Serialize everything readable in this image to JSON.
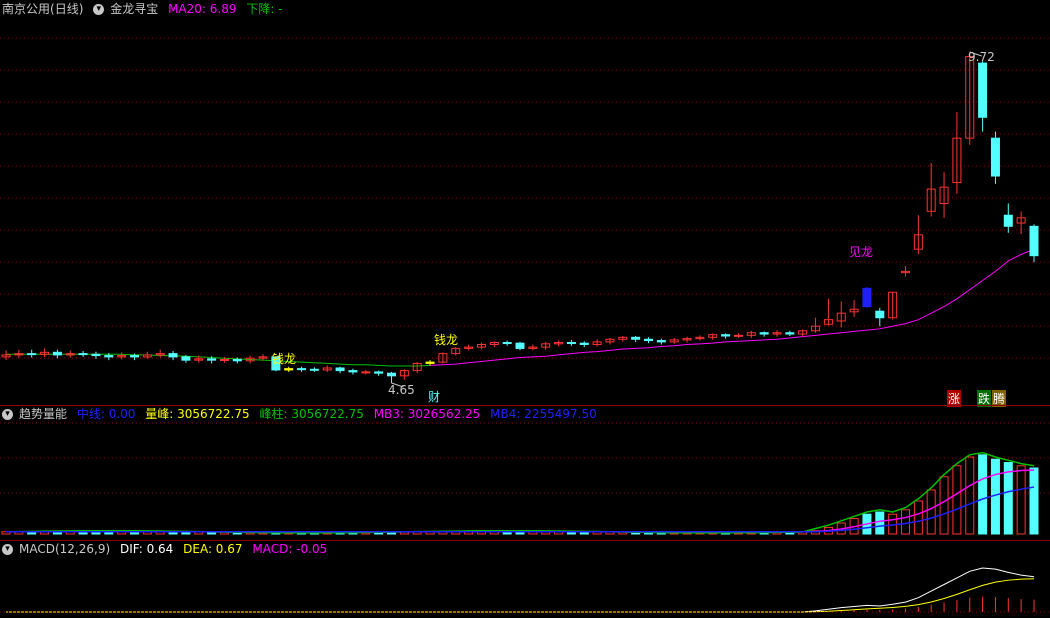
{
  "main_panel": {
    "stock_name": "南京公用",
    "period": "(日线)",
    "indicator_name": "金龙寻宝",
    "ma20_label": "MA20: 6.89",
    "trend_label": "下降: -",
    "signals": {
      "qianlong_1": "钱龙",
      "qianlong_2": "钱龙",
      "jianlong": "见龙",
      "cai": "财",
      "zhang": "涨",
      "die": "跌",
      "teng": "腾"
    },
    "high_label": "9.72",
    "low_label": "4.65"
  },
  "volume_panel": {
    "name": "趋势量能",
    "zhongxian": "中线: 0.00",
    "liangfeng": "量峰: 3056722.75",
    "fengzhu": "峰柱: 3056722.75",
    "mb3": "MB3: 3026562.25",
    "mb4": "MB4: 2255497.50"
  },
  "macd_panel": {
    "name": "MACD(12,26,9)",
    "dif": "DIF: 0.64",
    "dea": "DEA: 0.67",
    "macd": "MACD: -0.05"
  },
  "colors": {
    "up": "#ff3232",
    "down": "#54ffff",
    "ma_line": "#ff00ff",
    "green_line": "#00c000",
    "yellow": "#ffff00",
    "blue_line": "#2020ff",
    "grid": "#8b0000"
  },
  "chart_data": {
    "type": "candlestick",
    "price_range": [
      4.65,
      9.72
    ],
    "candles": [
      [
        5.05,
        5.08,
        5.15,
        5.0
      ],
      [
        5.08,
        5.1,
        5.16,
        5.03
      ],
      [
        5.1,
        5.09,
        5.16,
        5.04
      ],
      [
        5.09,
        5.12,
        5.18,
        5.05
      ],
      [
        5.12,
        5.08,
        5.16,
        5.03
      ],
      [
        5.08,
        5.1,
        5.15,
        5.04
      ],
      [
        5.1,
        5.09,
        5.14,
        5.05
      ],
      [
        5.09,
        5.07,
        5.13,
        5.02
      ],
      [
        5.07,
        5.05,
        5.11,
        5.0
      ],
      [
        5.05,
        5.07,
        5.12,
        5.01
      ],
      [
        5.07,
        5.05,
        5.1,
        5.0
      ],
      [
        5.05,
        5.08,
        5.13,
        5.02
      ],
      [
        5.08,
        5.1,
        5.16,
        5.04
      ],
      [
        5.1,
        5.05,
        5.14,
        5.0
      ],
      [
        5.05,
        5.0,
        5.08,
        4.96
      ],
      [
        5.0,
        5.02,
        5.07,
        4.96
      ],
      [
        5.02,
        5.0,
        5.06,
        4.95
      ],
      [
        5.0,
        5.01,
        5.05,
        4.96
      ],
      [
        5.01,
        4.99,
        5.04,
        4.95
      ],
      [
        4.99,
        5.03,
        5.07,
        4.95
      ],
      [
        5.03,
        5.05,
        5.09,
        4.99
      ],
      [
        5.05,
        4.85,
        5.06,
        4.83
      ],
      [
        4.85,
        4.87,
        4.9,
        4.82
      ],
      [
        4.87,
        4.86,
        4.9,
        4.82
      ],
      [
        4.86,
        4.85,
        4.89,
        4.82
      ],
      [
        4.85,
        4.88,
        4.92,
        4.82
      ],
      [
        4.88,
        4.84,
        4.9,
        4.8
      ],
      [
        4.84,
        4.82,
        4.87,
        4.78
      ],
      [
        4.82,
        4.82,
        4.85,
        4.78
      ],
      [
        4.82,
        4.8,
        4.84,
        4.76
      ],
      [
        4.8,
        4.76,
        4.82,
        4.65
      ],
      [
        4.76,
        4.84,
        4.86,
        4.7
      ],
      [
        4.84,
        4.95,
        4.97,
        4.8
      ],
      [
        4.95,
        4.97,
        5.0,
        4.92
      ],
      [
        4.97,
        5.1,
        5.12,
        4.95
      ],
      [
        5.1,
        5.18,
        5.2,
        5.07
      ],
      [
        5.18,
        5.2,
        5.24,
        5.15
      ],
      [
        5.2,
        5.24,
        5.27,
        5.17
      ],
      [
        5.24,
        5.27,
        5.29,
        5.2
      ],
      [
        5.27,
        5.26,
        5.3,
        5.22
      ],
      [
        5.26,
        5.18,
        5.28,
        5.15
      ],
      [
        5.18,
        5.2,
        5.24,
        5.15
      ],
      [
        5.2,
        5.25,
        5.28,
        5.16
      ],
      [
        5.25,
        5.27,
        5.3,
        5.21
      ],
      [
        5.27,
        5.26,
        5.31,
        5.22
      ],
      [
        5.26,
        5.24,
        5.29,
        5.2
      ],
      [
        5.24,
        5.28,
        5.32,
        5.21
      ],
      [
        5.28,
        5.32,
        5.34,
        5.24
      ],
      [
        5.32,
        5.35,
        5.37,
        5.28
      ],
      [
        5.35,
        5.32,
        5.37,
        5.28
      ],
      [
        5.32,
        5.3,
        5.35,
        5.26
      ],
      [
        5.3,
        5.28,
        5.33,
        5.24
      ],
      [
        5.28,
        5.31,
        5.34,
        5.25
      ],
      [
        5.31,
        5.33,
        5.36,
        5.27
      ],
      [
        5.33,
        5.35,
        5.38,
        5.3
      ],
      [
        5.35,
        5.39,
        5.41,
        5.31
      ],
      [
        5.39,
        5.37,
        5.41,
        5.33
      ],
      [
        5.37,
        5.38,
        5.41,
        5.34
      ],
      [
        5.38,
        5.42,
        5.45,
        5.34
      ],
      [
        5.42,
        5.4,
        5.44,
        5.36
      ],
      [
        5.4,
        5.42,
        5.46,
        5.36
      ],
      [
        5.42,
        5.4,
        5.45,
        5.37
      ],
      [
        5.4,
        5.45,
        5.47,
        5.36
      ],
      [
        5.45,
        5.52,
        5.65,
        5.42
      ],
      [
        5.55,
        5.62,
        5.94,
        5.53
      ],
      [
        5.6,
        5.72,
        5.9,
        5.5
      ],
      [
        5.74,
        5.78,
        5.92,
        5.66
      ],
      [
        6.1,
        5.82,
        6.12,
        5.8
      ],
      [
        5.75,
        5.65,
        5.8,
        5.52
      ],
      [
        5.65,
        6.04,
        6.04,
        5.62
      ],
      [
        6.34,
        6.36,
        6.44,
        6.28
      ],
      [
        6.7,
        6.92,
        7.22,
        6.62
      ],
      [
        7.28,
        7.62,
        8.02,
        7.2
      ],
      [
        7.4,
        7.65,
        7.88,
        7.18
      ],
      [
        7.72,
        8.4,
        8.8,
        7.55
      ],
      [
        8.4,
        9.65,
        9.72,
        8.3
      ],
      [
        9.55,
        8.72,
        9.58,
        8.5
      ],
      [
        8.4,
        7.82,
        8.5,
        7.7
      ],
      [
        7.22,
        7.05,
        7.4,
        6.95
      ],
      [
        7.1,
        7.18,
        7.28,
        6.93
      ],
      [
        7.05,
        6.6,
        7.08,
        6.5
      ]
    ],
    "ma20": [
      5.09,
      5.09,
      5.09,
      5.09,
      5.09,
      5.09,
      5.09,
      5.09,
      5.09,
      5.09,
      5.08,
      5.08,
      5.07,
      5.07,
      5.06,
      5.05,
      5.04,
      5.03,
      5.02,
      5.01,
      5.0,
      4.99,
      4.98,
      4.97,
      4.96,
      4.95,
      4.94,
      4.93,
      4.93,
      4.92,
      4.91,
      4.91,
      4.91,
      4.92,
      4.93,
      4.94,
      4.96,
      4.98,
      5.0,
      5.02,
      5.04,
      5.05,
      5.06,
      5.08,
      5.1,
      5.12,
      5.13,
      5.15,
      5.17,
      5.18,
      5.19,
      5.21,
      5.22,
      5.24,
      5.25,
      5.26,
      5.28,
      5.29,
      5.3,
      5.31,
      5.32,
      5.34,
      5.36,
      5.38,
      5.4,
      5.42,
      5.44,
      5.46,
      5.48,
      5.52,
      5.56,
      5.62,
      5.72,
      5.82,
      5.94,
      6.08,
      6.22,
      6.36,
      6.52,
      6.62,
      6.7
    ],
    "volume_bars": [
      0.02,
      0.02,
      0.02,
      0.02,
      0.02,
      0.02,
      0.02,
      0.02,
      0.02,
      0.02,
      0.02,
      0.02,
      0.02,
      0.02,
      0.02,
      0.02,
      0.02,
      0.02,
      0.02,
      0.02,
      0.02,
      0.02,
      0.02,
      0.02,
      0.02,
      0.02,
      0.02,
      0.02,
      0.02,
      0.02,
      0.02,
      0.02,
      0.02,
      0.02,
      0.02,
      0.02,
      0.02,
      0.02,
      0.02,
      0.02,
      0.02,
      0.02,
      0.02,
      0.02,
      0.02,
      0.02,
      0.02,
      0.02,
      0.02,
      0.02,
      0.02,
      0.02,
      0.02,
      0.02,
      0.02,
      0.02,
      0.02,
      0.02,
      0.02,
      0.02,
      0.02,
      0.02,
      0.02,
      0.03,
      0.06,
      0.1,
      0.14,
      0.18,
      0.2,
      0.18,
      0.22,
      0.3,
      0.4,
      0.52,
      0.62,
      0.7,
      0.72,
      0.68,
      0.65,
      0.62,
      0.6
    ],
    "macd_dif": [
      0,
      0,
      0,
      0,
      0,
      0,
      0,
      0,
      0,
      0,
      0,
      0,
      0,
      0,
      0,
      0,
      0,
      0,
      0,
      0,
      0,
      0,
      0,
      0,
      0,
      0,
      0,
      0,
      0,
      0,
      0,
      0,
      0,
      0,
      0,
      0,
      0,
      0,
      0,
      0,
      0,
      0,
      0,
      0,
      0,
      0,
      0,
      0,
      0,
      0,
      0,
      0,
      0,
      0,
      0,
      0,
      0,
      0,
      0,
      0,
      0,
      0,
      0,
      0.02,
      0.05,
      0.08,
      0.1,
      0.12,
      0.11,
      0.14,
      0.18,
      0.26,
      0.38,
      0.5,
      0.62,
      0.74,
      0.8,
      0.78,
      0.72,
      0.67,
      0.64
    ]
  }
}
